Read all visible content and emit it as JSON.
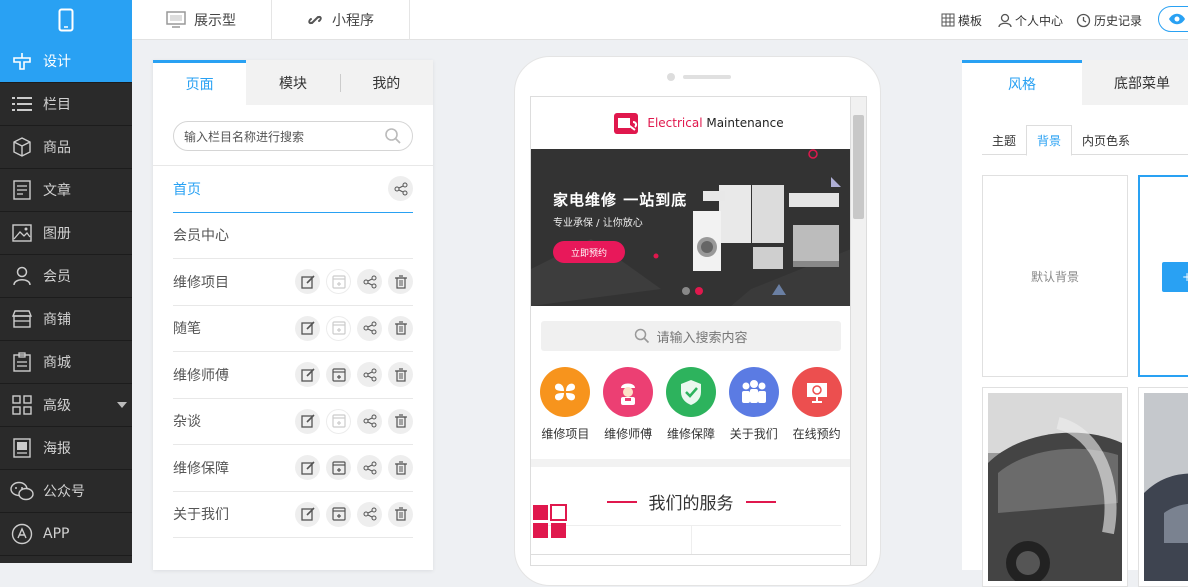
{
  "topbar": {
    "tabs": [
      {
        "label": "展示型",
        "icon": "monitor-icon"
      },
      {
        "label": "小程序",
        "icon": "link-icon"
      }
    ],
    "right": [
      {
        "label": "模板",
        "icon": "grid-icon"
      },
      {
        "label": "个人中心",
        "icon": "user-icon"
      },
      {
        "label": "历史记录",
        "icon": "clock-icon"
      }
    ],
    "preview_icon": "eye-icon"
  },
  "sidebar": {
    "items": [
      {
        "label": "设计",
        "icon": "design-icon",
        "active": true
      },
      {
        "label": "栏目",
        "icon": "list-icon"
      },
      {
        "label": "商品",
        "icon": "box-icon"
      },
      {
        "label": "文章",
        "icon": "article-icon"
      },
      {
        "label": "图册",
        "icon": "image-icon"
      },
      {
        "label": "会员",
        "icon": "member-icon"
      },
      {
        "label": "商铺",
        "icon": "shop-icon"
      },
      {
        "label": "商城",
        "icon": "mall-icon"
      },
      {
        "label": "高级",
        "icon": "advanced-icon",
        "has_caret": true
      },
      {
        "label": "海报",
        "icon": "poster-icon"
      },
      {
        "label": "公众号",
        "icon": "wechat-icon"
      },
      {
        "label": "APP",
        "icon": "app-icon"
      }
    ]
  },
  "left_panel": {
    "tabs": [
      {
        "label": "页面",
        "active": true
      },
      {
        "label": "模块"
      },
      {
        "label": "我的"
      }
    ],
    "search_placeholder": "输入栏目名称进行搜索",
    "pages": [
      {
        "label": "首页",
        "active": true
      },
      {
        "label": "会员中心"
      },
      {
        "label": "维修项目"
      },
      {
        "label": "随笔"
      },
      {
        "label": "维修师傅"
      },
      {
        "label": "杂谈"
      },
      {
        "label": "维修保障"
      },
      {
        "label": "关于我们"
      }
    ]
  },
  "phone": {
    "logo_brand": "Electrical",
    "logo_rest": " Maintenance",
    "banner_title": "家电维修  一站到底",
    "banner_subtitle": "专业承保 / 让你放心",
    "banner_button": "立即预约",
    "search_placeholder": "请输入搜索内容",
    "icons": [
      {
        "label": "维修项目",
        "color": "#f7941d",
        "icon": "clover-icon"
      },
      {
        "label": "维修师傅",
        "color": "#ec3f73",
        "icon": "worker-icon"
      },
      {
        "label": "维修保障",
        "color": "#2db35d",
        "icon": "shield-icon"
      },
      {
        "label": "关于我们",
        "color": "#5b7be3",
        "icon": "people-icon"
      },
      {
        "label": "在线预约",
        "color": "#ec4f4f",
        "icon": "screen-icon"
      }
    ],
    "section_title": "我们的服务",
    "accent": "#e0184d"
  },
  "right_panel": {
    "tabs": [
      {
        "label": "风格",
        "active": true
      },
      {
        "label": "底部菜单"
      }
    ],
    "subtabs": [
      {
        "label": "主题"
      },
      {
        "label": "背景",
        "active": true
      },
      {
        "label": "内页色系"
      }
    ],
    "default_bg_label": "默认背景",
    "custom_btn_label": "+"
  },
  "colors": {
    "accent": "#29a1f3",
    "sidebar_bg": "#2a2a2a"
  }
}
